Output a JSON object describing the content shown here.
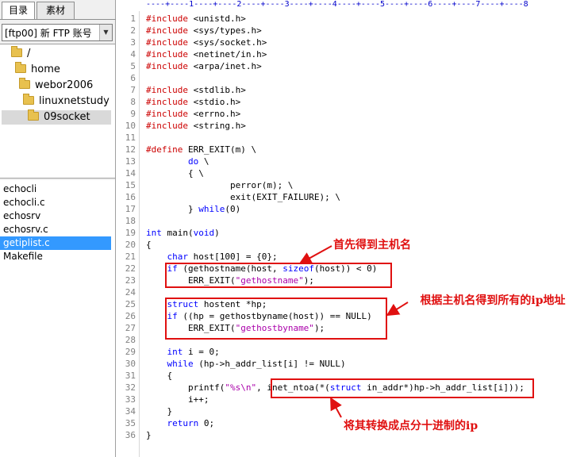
{
  "tabs": [
    "目录",
    "素材"
  ],
  "account": {
    "label": "[ftp00] 新 FTP 账号"
  },
  "tree": [
    {
      "label": "/",
      "indent": 0
    },
    {
      "label": "home",
      "indent": 1
    },
    {
      "label": "webor2006",
      "indent": 2
    },
    {
      "label": "linuxnetstudy",
      "indent": 3
    },
    {
      "label": "09socket",
      "indent": 4,
      "selected": true
    }
  ],
  "files": [
    "echocli",
    "echocli.c",
    "echosrv",
    "echosrv.c",
    "getiplist.c",
    "Makefile"
  ],
  "selected_file": "getiplist.c",
  "ruler": "----+----1----+----2----+----3----+----4----+----5----+----6----+----7----+----8",
  "code": [
    "<span class=\"pp\">#include</span> &lt;unistd.h&gt;",
    "<span class=\"pp\">#include</span> &lt;sys/types.h&gt;",
    "<span class=\"pp\">#include</span> &lt;sys/socket.h&gt;",
    "<span class=\"pp\">#include</span> &lt;netinet/in.h&gt;",
    "<span class=\"pp\">#include</span> &lt;arpa/inet.h&gt;",
    "",
    "<span class=\"pp\">#include</span> &lt;stdlib.h&gt;",
    "<span class=\"pp\">#include</span> &lt;stdio.h&gt;",
    "<span class=\"pp\">#include</span> &lt;errno.h&gt;",
    "<span class=\"pp\">#include</span> &lt;string.h&gt;",
    "",
    "<span class=\"pp\">#define</span> ERR_EXIT(m) \\",
    "        <span class=\"kw\">do</span> \\",
    "        { \\",
    "                perror(m); \\",
    "                exit(EXIT_FAILURE); \\",
    "        } <span class=\"kw\">while</span>(0)",
    "",
    "<span class=\"kw\">int</span> main(<span class=\"kw\">void</span>)",
    "{",
    "    <span class=\"kw\">char</span> host[100] = {0};",
    "    <span class=\"kw\">if</span> (gethostname(host, <span class=\"kw\">sizeof</span>(host)) &lt; 0)",
    "        ERR_EXIT(<span class=\"st\">\"gethostname\"</span>);",
    "",
    "    <span class=\"kw\">struct</span> hostent *hp;",
    "    <span class=\"kw\">if</span> ((hp = gethostbyname(host)) == NULL)",
    "        ERR_EXIT(<span class=\"st\">\"gethostbyname\"</span>);",
    "",
    "    <span class=\"kw\">int</span> i = 0;",
    "    <span class=\"kw\">while</span> (hp-&gt;h_addr_list[i] != NULL)",
    "    {",
    "        printf(<span class=\"st\">\"%s\\n\"</span>, inet_ntoa(*(<span class=\"kw\">struct</span> in_addr*)hp-&gt;h_addr_list[i]));",
    "        i++;",
    "    }",
    "    <span class=\"kw\">return</span> 0;",
    "}"
  ],
  "annotations": [
    "首先得到主机名",
    "根据主机名得到所有的ip地址",
    "将其转换成点分十进制的ip"
  ],
  "colors": {
    "preprocessor": "#cc0000",
    "keyword": "#0000ff",
    "string": "#aa00aa",
    "annotation": "#e01010",
    "selection": "#3399ff"
  }
}
